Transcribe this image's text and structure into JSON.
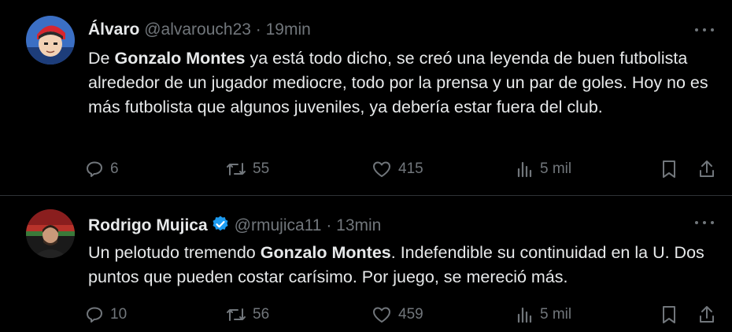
{
  "tweets": [
    {
      "name": "Álvaro",
      "handle": "@alvarouch23",
      "separator": "·",
      "time": "19min",
      "text_parts": [
        "De ",
        "Gonzalo Montes",
        " ya está todo dicho, se creó una leyenda de buen futbolista alrededor de un jugador mediocre, todo por la prensa y un par de goles. Hoy no es más futbolista que algunos juveniles, ya debería estar fuera del club."
      ],
      "replies": "6",
      "reposts": "55",
      "likes": "415",
      "views": "5 mil"
    },
    {
      "name": "Rodrigo Mujica",
      "verified": true,
      "handle": "@rmujica11",
      "separator": "·",
      "time": "13min",
      "text_parts": [
        "Un pelotudo tremendo ",
        "Gonzalo Montes",
        ". Indefendible su continuidad en la U. Dos puntos que pueden costar carísimo. Por juego, se mereció más."
      ],
      "replies": "10",
      "reposts": "56",
      "likes": "459",
      "views": "5 mil"
    }
  ],
  "colors": {
    "background": "#000000",
    "text": "#e7e9ea",
    "muted": "#71767b",
    "verified": "#1d9bf0",
    "divider": "#2f3336"
  }
}
